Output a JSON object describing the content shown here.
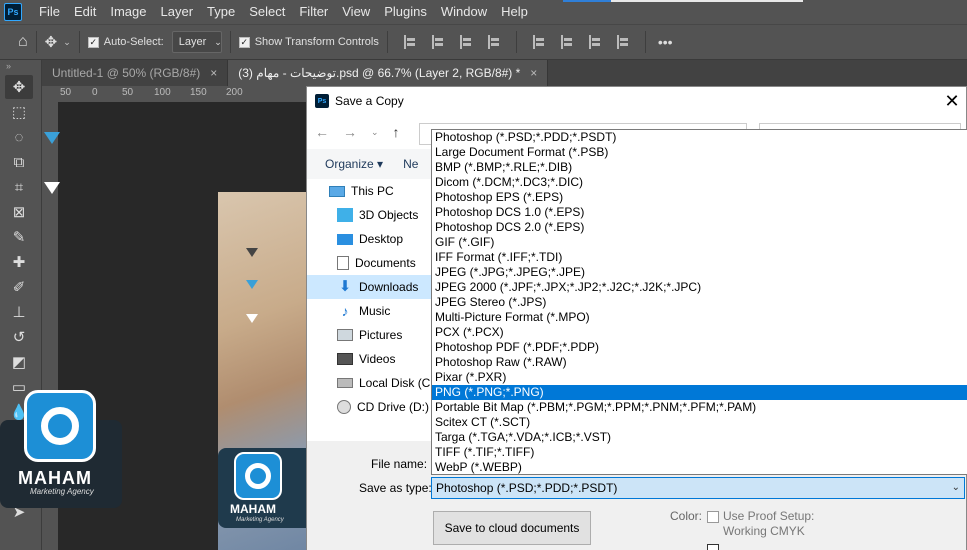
{
  "app": {
    "logo": "Ps",
    "menu": [
      "File",
      "Edit",
      "Image",
      "Layer",
      "Type",
      "Select",
      "Filter",
      "View",
      "Plugins",
      "Window",
      "Help"
    ]
  },
  "options": {
    "auto_select_label": "Auto-Select:",
    "auto_select_value": "Layer",
    "transform_label": "Show Transform Controls",
    "more": "•••"
  },
  "tabs": [
    {
      "label": "Untitled-1 @ 50% (RGB/8#)",
      "close": "×"
    },
    {
      "label": "(3) توضيحات - مهام.psd @ 66.7% (Layer 2, RGB/8#) *",
      "close": "×"
    }
  ],
  "ruler": [
    "50",
    "0",
    "50",
    "100",
    "150",
    "200"
  ],
  "brand": {
    "name": "MAHAM",
    "tagline": "Marketing Agency"
  },
  "dialog": {
    "title": "Save a Copy",
    "close": "✕",
    "organize": "Organize ▾",
    "new_folder": "Ne",
    "nav_items": [
      "This PC",
      "3D Objects",
      "Desktop",
      "Documents",
      "Downloads",
      "Music",
      "Pictures",
      "Videos",
      "Local Disk (C:",
      "CD Drive (D:)"
    ],
    "selected_nav": "Downloads",
    "file_types": [
      "Photoshop (*.PSD;*.PDD;*.PSDT)",
      "Large Document Format (*.PSB)",
      "BMP (*.BMP;*.RLE;*.DIB)",
      "Dicom (*.DCM;*.DC3;*.DIC)",
      "Photoshop EPS (*.EPS)",
      "Photoshop DCS 1.0 (*.EPS)",
      "Photoshop DCS 2.0 (*.EPS)",
      "GIF (*.GIF)",
      "IFF Format (*.IFF;*.TDI)",
      "JPEG (*.JPG;*.JPEG;*.JPE)",
      "JPEG 2000 (*.JPF;*.JPX;*.JP2;*.J2C;*.J2K;*.JPC)",
      "JPEG Stereo (*.JPS)",
      "Multi-Picture Format (*.MPO)",
      "PCX (*.PCX)",
      "Photoshop PDF (*.PDF;*.PDP)",
      "Photoshop Raw (*.RAW)",
      "Pixar (*.PXR)",
      "PNG (*.PNG;*.PNG)",
      "Portable Bit Map (*.PBM;*.PGM;*.PPM;*.PNM;*.PFM;*.PAM)",
      "Scitex CT (*.SCT)",
      "Targa (*.TGA;*.VDA;*.ICB;*.VST)",
      "TIFF (*.TIF;*.TIFF)",
      "WebP (*.WEBP)"
    ],
    "highlighted_type": "PNG (*.PNG;*.PNG)",
    "file_name_label": "File name:",
    "save_as_type_label": "Save as type:",
    "save_as_type_value": "Photoshop (*.PSD;*.PDD;*.PSDT)",
    "cloud_button": "Save to cloud documents",
    "color_label": "Color:",
    "proof_label_1": "Use Proof Setup:",
    "proof_label_2": "Working CMYK"
  },
  "colors": {
    "ps_bg": "#535353",
    "accent": "#0078d7",
    "guide_blue": "#3aa0d8"
  }
}
